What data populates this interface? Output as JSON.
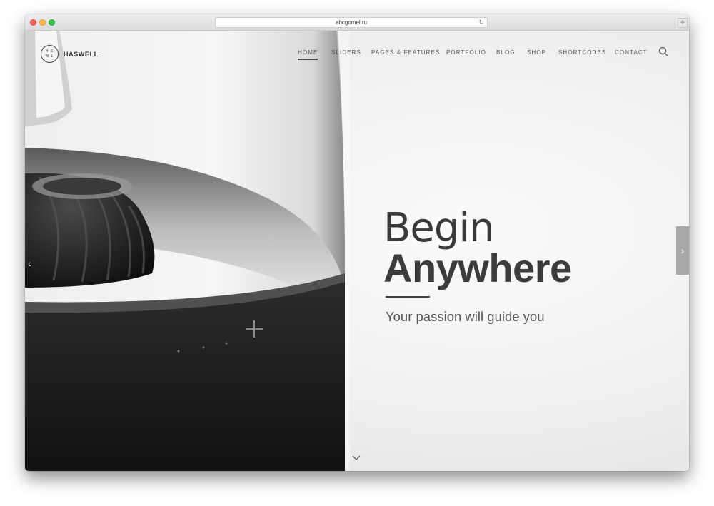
{
  "browser": {
    "url": "abcgomel.ru",
    "reload_icon": "reload-icon",
    "new_tab_label": "+"
  },
  "header": {
    "logo_letters": "H S W L",
    "brand": "HASWELL",
    "nav": [
      {
        "label": "HOME",
        "active": true
      },
      {
        "label": "SLIDERS",
        "active": false
      },
      {
        "label": "PAGES & FEATURES",
        "active": false
      },
      {
        "label": "PORTFOLIO",
        "active": false
      },
      {
        "label": "BLOG",
        "active": false
      },
      {
        "label": "SHOP",
        "active": false
      },
      {
        "label": "SHORTCODES",
        "active": false
      },
      {
        "label": "CONTACT",
        "active": false
      }
    ],
    "search_icon": "search-icon"
  },
  "hero": {
    "line1": "Begin",
    "line2": "Anywhere",
    "tagline": "Your passion will guide you"
  },
  "slider": {
    "prev_icon": "chevron-left-icon",
    "prev_glyph": "‹",
    "next_icon": "chevron-right-icon",
    "next_glyph": "›",
    "scroll_icon": "chevron-down-icon"
  },
  "colors": {
    "text_dark": "#3a3a3a",
    "arrow_bg": "#a9a9a9"
  }
}
